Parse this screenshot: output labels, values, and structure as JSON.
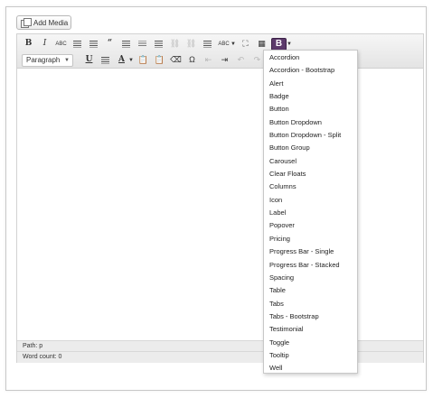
{
  "media": {
    "add_media_label": "Add Media"
  },
  "toolbar": {
    "bold_label": "B",
    "italic_label": "I",
    "strike_label": "ABC",
    "quote_label": "“",
    "spell_label": "ABC",
    "underline_label": "U",
    "text_color_label": "A",
    "omega_label": "Ω",
    "shortcode_button_label": "B",
    "format_select_value": "Paragraph"
  },
  "status": {
    "path_label": "Path: p",
    "word_count_label": "Word count: 0"
  },
  "shortcode_menu": {
    "items": [
      "Accordion",
      "Accordion - Bootstrap",
      "Alert",
      "Badge",
      "Button",
      "Button Dropdown",
      "Button Dropdown - Split",
      "Button Group",
      "Carousel",
      "Clear Floats",
      "Columns",
      "Icon",
      "Label",
      "Popover",
      "Pricing",
      "Progress Bar - Single",
      "Progress Bar - Stacked",
      "Spacing",
      "Table",
      "Tabs",
      "Tabs - Bootstrap",
      "Testimonial",
      "Toggle",
      "Tooltip",
      "Well"
    ]
  },
  "colors": {
    "shortcode_button_bg": "#5c3a6b",
    "toolbar_bg": "#e9e9e9",
    "status_bg": "#ececec"
  }
}
